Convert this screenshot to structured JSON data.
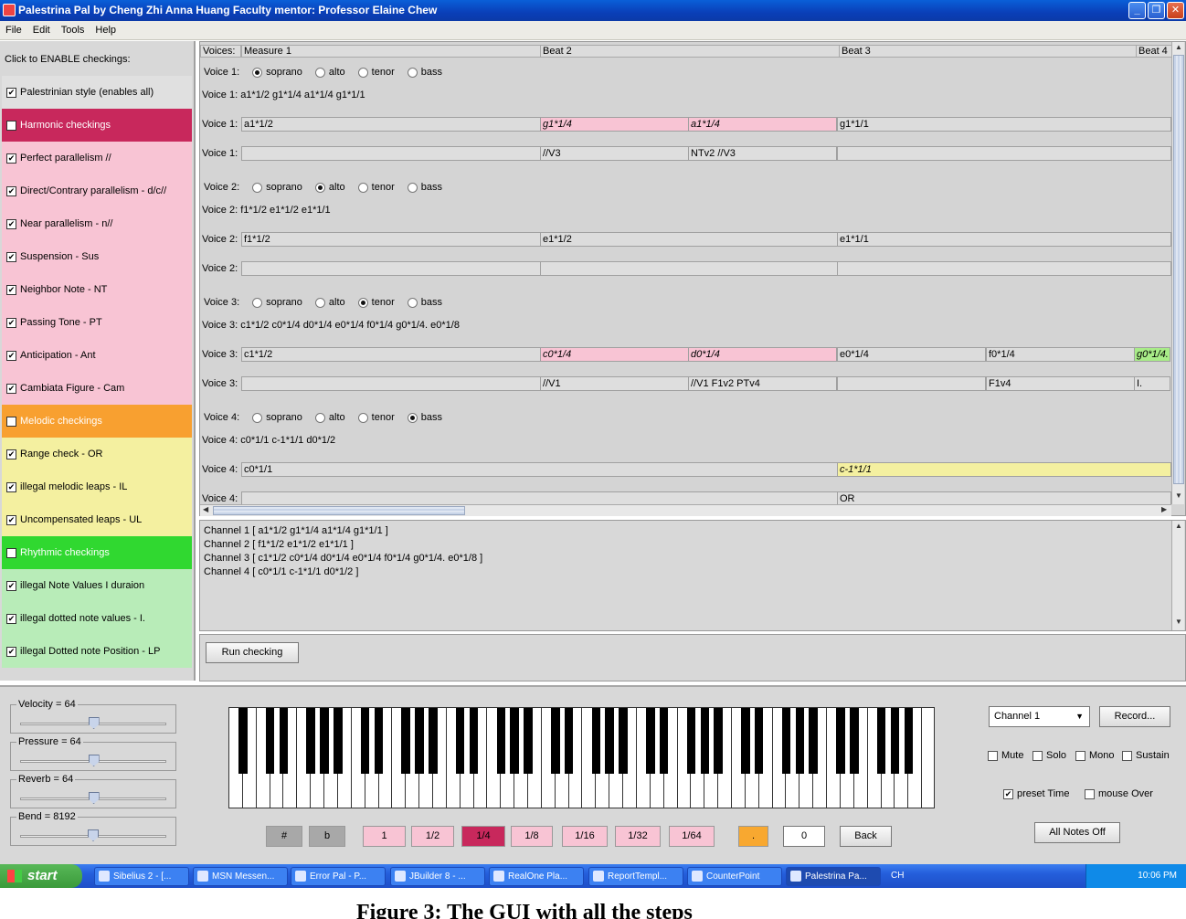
{
  "window": {
    "title": "Palestrina Pal by Cheng Zhi Anna Huang  Faculty mentor: Professor Elaine Chew",
    "buttons": [
      "_",
      "❐",
      "✕"
    ]
  },
  "menu": [
    "File",
    "Edit",
    "Tools",
    "Help"
  ],
  "left_panel": {
    "header": "Click to ENABLE checkings:",
    "items": [
      {
        "label": "Palestrinian style (enables all)",
        "checked": true,
        "style": "gray"
      },
      {
        "label": "Harmonic checkings",
        "checked": true,
        "style": "harm"
      },
      {
        "label": "Perfect parallelism   //",
        "checked": true,
        "style": "pink"
      },
      {
        "label": "Direct/Contrary parallelism - d/c//",
        "checked": true,
        "style": "pink"
      },
      {
        "label": "Near parallelism - n//",
        "checked": true,
        "style": "pink"
      },
      {
        "label": "Suspension - Sus",
        "checked": true,
        "style": "pink"
      },
      {
        "label": "Neighbor Note - NT",
        "checked": true,
        "style": "pink"
      },
      {
        "label": "Passing Tone - PT",
        "checked": true,
        "style": "pink"
      },
      {
        "label": "Anticipation - Ant",
        "checked": true,
        "style": "pink"
      },
      {
        "label": "Cambiata Figure - Cam",
        "checked": true,
        "style": "pink"
      },
      {
        "label": "Melodic checkings",
        "checked": true,
        "style": "mel"
      },
      {
        "label": "Range check - OR",
        "checked": true,
        "style": "yellow"
      },
      {
        "label": "illegal melodic leaps - IL",
        "checked": true,
        "style": "yellow"
      },
      {
        "label": "Uncompensated leaps - UL",
        "checked": true,
        "style": "yellow"
      },
      {
        "label": "Rhythmic checkings",
        "checked": true,
        "style": "rhy"
      },
      {
        "label": "illegal Note Values   I duraion",
        "checked": true,
        "style": "green"
      },
      {
        "label": "illegal dotted note values - I.",
        "checked": true,
        "style": "green"
      },
      {
        "label": "illegal Dotted note Position - LP",
        "checked": true,
        "style": "green"
      }
    ]
  },
  "score": {
    "header": {
      "voices": "Voices:",
      "measure": "Measure 1",
      "beat2": "Beat 2",
      "beat3": "Beat 3",
      "beat4": "Beat 4"
    },
    "radio_options": [
      "soprano",
      "alto",
      "tenor",
      "bass"
    ],
    "voices": [
      {
        "label": "Voice 1:",
        "selected": 0,
        "summary": "Voice 1: a1*1/2 g1*1/4 a1*1/4 g1*1/1",
        "notes_label": "Voice 1:",
        "notes": [
          {
            "text": "a1*1/2",
            "hl": ""
          },
          {
            "text": "g1*1/4",
            "hl": "pink"
          },
          {
            "text": "a1*1/4",
            "hl": "pink"
          },
          {
            "text": "g1*1/1",
            "hl": ""
          }
        ],
        "annot_label": "Voice 1:",
        "annots": [
          "",
          "//V3",
          "NTv2 //V3",
          ""
        ]
      },
      {
        "label": "Voice 2:",
        "selected": 1,
        "summary": "Voice 2: f1*1/2 e1*1/2 e1*1/1",
        "notes_label": "Voice 2:",
        "notes": [
          {
            "text": "f1*1/2",
            "hl": ""
          },
          {
            "text": "e1*1/2",
            "hl": ""
          },
          {
            "text": "e1*1/1",
            "hl": ""
          }
        ],
        "annot_label": "Voice 2:",
        "annots": [
          "",
          "",
          ""
        ]
      },
      {
        "label": "Voice 3:",
        "selected": 2,
        "summary": "Voice 3: c1*1/2 c0*1/4 d0*1/4 e0*1/4 f0*1/4 g0*1/4. e0*1/8",
        "notes_label": "Voice 3:",
        "notes": [
          {
            "text": "c1*1/2",
            "hl": ""
          },
          {
            "text": "c0*1/4",
            "hl": "pink"
          },
          {
            "text": "d0*1/4",
            "hl": "pink"
          },
          {
            "text": "e0*1/4",
            "hl": ""
          },
          {
            "text": "f0*1/4",
            "hl": ""
          },
          {
            "text": "g0*1/4.",
            "hl": "green"
          }
        ],
        "annot_label": "Voice 3:",
        "annots": [
          "",
          "//V1",
          "//V1 F1v2 PTv4",
          "",
          "F1v4",
          "I."
        ]
      },
      {
        "label": "Voice 4:",
        "selected": 3,
        "summary": "Voice 4: c0*1/1 c-1*1/1 d0*1/2",
        "notes_label": "Voice 4:",
        "notes": [
          {
            "text": "c0*1/1",
            "hl": ""
          },
          {
            "text": "c-1*1/1",
            "hl": "yellow"
          }
        ],
        "annot_label": "Voice 4:",
        "annots": [
          "",
          "OR"
        ]
      }
    ]
  },
  "channels": [
    "Channel 1 [ a1*1/2 g1*1/4 a1*1/4 g1*1/1 ]",
    "Channel 2 [ f1*1/2 e1*1/2 e1*1/1 ]",
    "Channel 3 [ c1*1/2 c0*1/4 d0*1/4 e0*1/4 f0*1/4 g0*1/4. e0*1/8 ]",
    "Channel 4 [ c0*1/1 c-1*1/1 d0*1/2 ]"
  ],
  "run_button": "Run checking",
  "midi": {
    "sliders": [
      {
        "label": "Velocity = 64",
        "value": 64,
        "max": 127
      },
      {
        "label": "Pressure = 64",
        "value": 64,
        "max": 127
      },
      {
        "label": "Reverb = 64",
        "value": 64,
        "max": 127
      },
      {
        "label": "Bend = 8192",
        "value": 8192,
        "max": 16383
      }
    ],
    "channel_select": "Channel 1",
    "record": "Record...",
    "options": [
      {
        "label": "Mute",
        "checked": false
      },
      {
        "label": "Solo",
        "checked": false
      },
      {
        "label": "Mono",
        "checked": false
      },
      {
        "label": "Sustain",
        "checked": false
      }
    ],
    "preset_time": {
      "label": "preset Time",
      "checked": true
    },
    "mouse_over": {
      "label": "mouse Over",
      "checked": false
    },
    "all_notes_off": "All Notes Off",
    "accidentals": [
      "#",
      "b"
    ],
    "durations": [
      "1",
      "1/2",
      "1/4",
      "1/8",
      "1/16",
      "1/32",
      "1/64"
    ],
    "selected_duration": "1/4",
    "dot": ".",
    "octave": "0",
    "back": "Back"
  },
  "taskbar": {
    "start": "start",
    "tasks": [
      "Sibelius 2 - [...",
      "MSN Messen...",
      "Error Pal - P...",
      "JBuilder 8 - ...",
      "RealOne Pla...",
      "ReportTempl...",
      "CounterPoint",
      "Palestrina Pa..."
    ],
    "active_task": 7,
    "lang": "CH",
    "clock": "10:06 PM"
  },
  "caption": "Figure 3: The GUI with all the steps"
}
